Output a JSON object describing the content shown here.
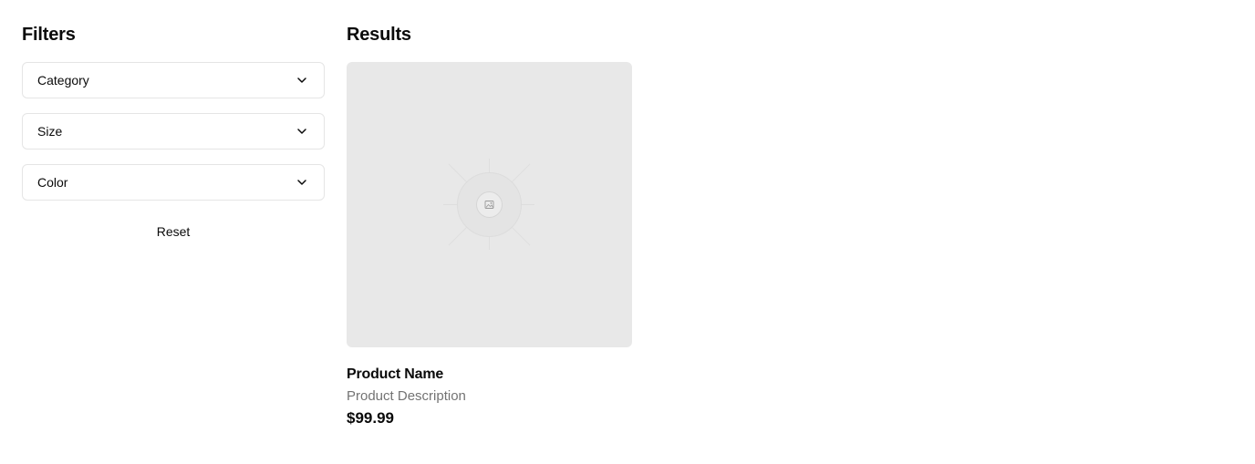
{
  "filters": {
    "title": "Filters",
    "items": [
      {
        "label": "Category",
        "icon": "chevron-down-icon"
      },
      {
        "label": "Size",
        "icon": "chevron-down-icon"
      },
      {
        "label": "Color",
        "icon": "chevron-down-icon"
      }
    ],
    "reset_label": "Reset"
  },
  "results": {
    "title": "Results",
    "products": [
      {
        "name": "Product Name",
        "description": "Product Description",
        "price": "$99.99",
        "image_icon": "image-placeholder-icon"
      }
    ]
  },
  "colors": {
    "border": "#e5e5e5",
    "image_placeholder_bg": "#e8e8e8",
    "muted_text": "#737373",
    "text": "#0a0a0a"
  }
}
